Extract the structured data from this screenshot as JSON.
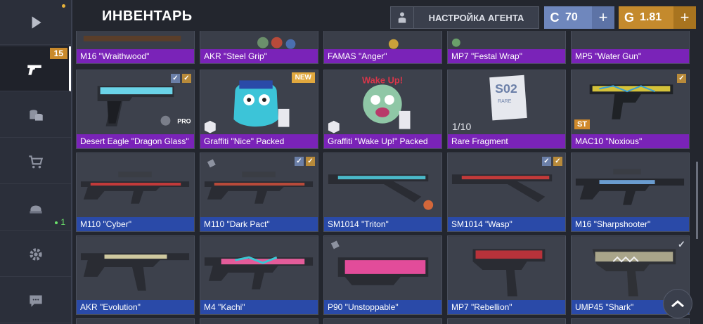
{
  "header": {
    "title": "ИНВЕНТАРЬ",
    "agent_button": "НАСТРОЙКА АГЕНТА",
    "currency_silver": "70",
    "currency_gold": "1.81"
  },
  "sidebar": {
    "inventory_badge": "15",
    "online_count": "1"
  },
  "colors": {
    "rarity_purple": "#7a23b8",
    "rarity_blue": "#2a4aa8",
    "gold": "#c48a2d",
    "silver": "#6f87bd"
  },
  "rows": [
    [
      {
        "name": "M16 \"Wraithwood\"",
        "rarity": "purple"
      },
      {
        "name": "AKR \"Steel Grip\"",
        "rarity": "purple"
      },
      {
        "name": "FAMAS \"Anger\"",
        "rarity": "purple"
      },
      {
        "name": "MP7 \"Festal Wrap\"",
        "rarity": "purple"
      },
      {
        "name": "MP5 \"Water Gun\"",
        "rarity": "purple"
      }
    ],
    [
      {
        "name": "Desert Eagle \"Dragon Glass\"",
        "rarity": "purple"
      },
      {
        "name": "Graffiti \"Nice\" Packed",
        "rarity": "purple",
        "tag": "NEW"
      },
      {
        "name": "Graffiti \"Wake Up!\" Packed",
        "rarity": "purple"
      },
      {
        "name": "Rare Fragment",
        "rarity": "purple",
        "count": "1/10",
        "fragment_code": "S02",
        "fragment_label": "RARE"
      },
      {
        "name": "MAC10 \"Noxious\"",
        "rarity": "purple",
        "tag": "ST"
      }
    ],
    [
      {
        "name": "M110 \"Cyber\"",
        "rarity": "blue"
      },
      {
        "name": "M110 \"Dark Pact\"",
        "rarity": "blue"
      },
      {
        "name": "SM1014 \"Triton\"",
        "rarity": "blue"
      },
      {
        "name": "SM1014 \"Wasp\"",
        "rarity": "blue"
      },
      {
        "name": "M16 \"Sharpshooter\"",
        "rarity": "blue"
      }
    ],
    [
      {
        "name": "AKR \"Evolution\"",
        "rarity": "blue"
      },
      {
        "name": "M4 \"Kachi\"",
        "rarity": "blue"
      },
      {
        "name": "P90 \"Unstoppable\"",
        "rarity": "blue"
      },
      {
        "name": "MP7 \"Rebellion\"",
        "rarity": "blue"
      },
      {
        "name": "UMP45 \"Shark\"",
        "rarity": "blue"
      }
    ]
  ],
  "sticker_texts": {
    "deagle_sticker": "PRO",
    "wake_up": "Wake Up!"
  }
}
